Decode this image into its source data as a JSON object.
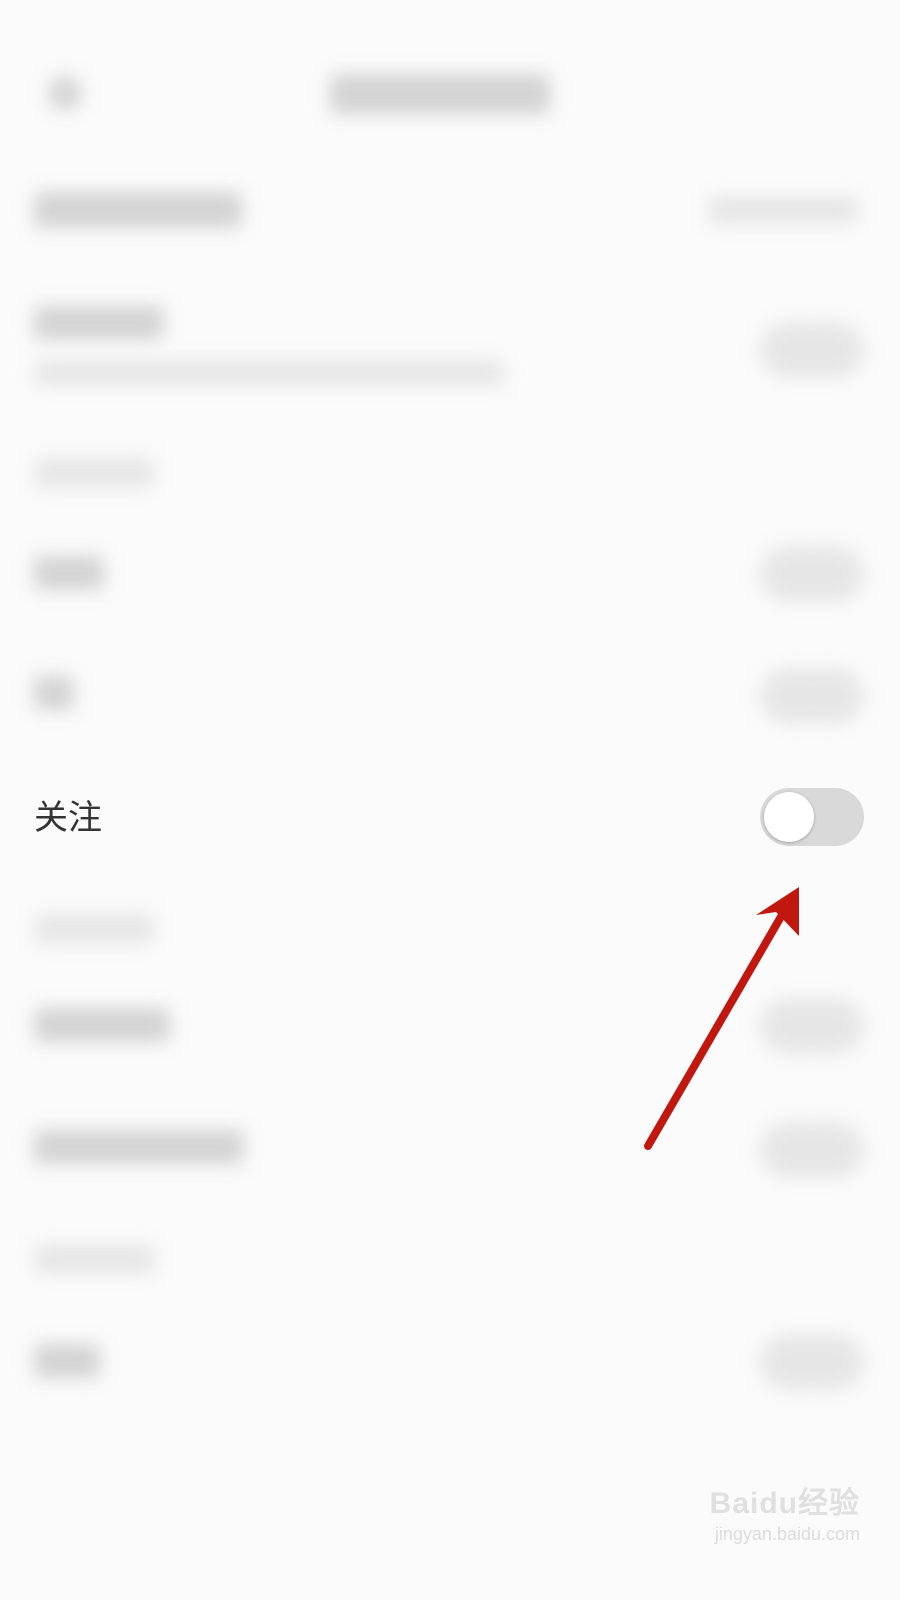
{
  "follow_row": {
    "label": "关注",
    "toggle_on": false
  },
  "annotation": {
    "arrow_color": "#c0180f"
  },
  "watermark": {
    "brand": "Baidu经验",
    "url": "jingyan.baidu.com"
  },
  "colors": {
    "background": "#fbfbfb",
    "toggle_off": "#d9d9d9",
    "label_text": "#333333"
  }
}
